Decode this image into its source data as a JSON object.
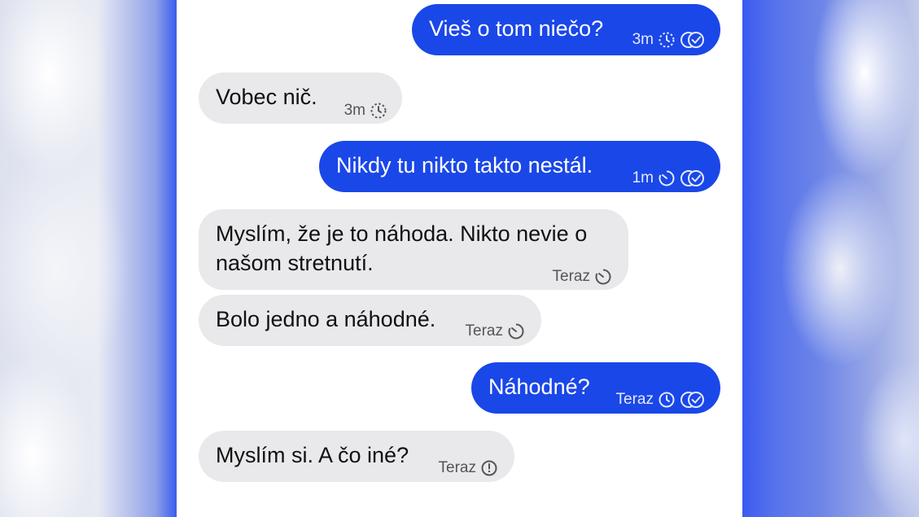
{
  "colors": {
    "outgoing_bubble": "#1a47e8",
    "incoming_bubble": "#e9e9eb",
    "background_accent": "#3b5bee"
  },
  "messages": [
    {
      "direction": "outgoing",
      "text": "Vieš o tom niečo?",
      "time": "3m",
      "status_icon": "sending-clock-icon",
      "receipt_icon": "double-check-icon"
    },
    {
      "direction": "incoming",
      "text": "Vobec nič.",
      "time": "3m",
      "status_icon": "sending-clock-icon"
    },
    {
      "direction": "outgoing",
      "text": "Nikdy tu nikto takto nestál.",
      "time": "1m",
      "status_icon": "timer-icon",
      "receipt_icon": "double-check-icon"
    },
    {
      "direction": "incoming",
      "text_line1": "Myslím, že je to náhoda. Nikto nevie o",
      "text_line2": "našom stretnutí.",
      "time": "Teraz",
      "status_icon": "timer-icon"
    },
    {
      "direction": "incoming",
      "text": "Bolo jedno a náhodné.",
      "time": "Teraz",
      "status_icon": "timer-icon"
    },
    {
      "direction": "outgoing",
      "text": "Náhodné?",
      "time": "Teraz",
      "status_icon": "clock-icon",
      "receipt_icon": "double-check-icon"
    },
    {
      "direction": "incoming",
      "text": "Myslím si. A čo iné?",
      "time": "Teraz",
      "status_icon": "clock-icon"
    }
  ]
}
